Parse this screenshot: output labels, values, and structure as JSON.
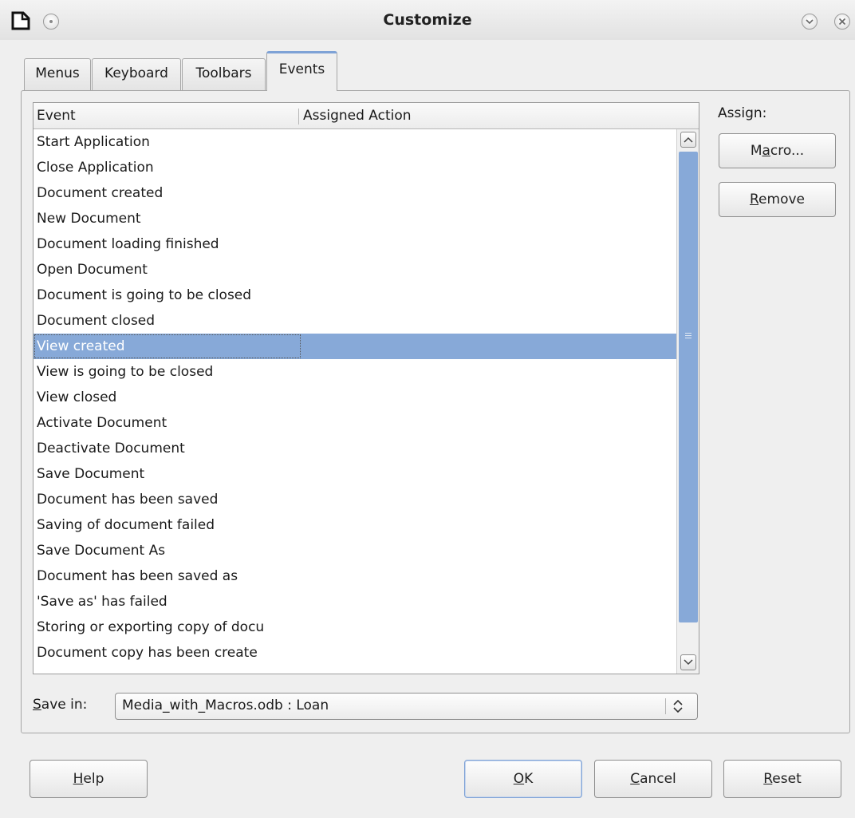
{
  "window": {
    "title": "Customize"
  },
  "tabs": [
    {
      "label": "Menus",
      "active": false
    },
    {
      "label": "Keyboard",
      "active": false
    },
    {
      "label": "Toolbars",
      "active": false
    },
    {
      "label": "Events",
      "active": true
    }
  ],
  "events_list": {
    "columns": [
      "Event",
      "Assigned Action"
    ],
    "selected_index": 8,
    "rows": [
      "Start Application",
      "Close Application",
      "Document created",
      "New Document",
      "Document loading finished",
      "Open Document",
      "Document is going to be closed",
      "Document closed",
      "View created",
      "View is going to be closed",
      "View closed",
      "Activate Document",
      "Deactivate Document",
      "Save Document",
      "Document has been saved",
      "Saving of document failed",
      "Save Document As",
      "Document has been saved as",
      "'Save as' has failed",
      "Storing or exporting copy of docu",
      "Document copy has been create"
    ]
  },
  "assign": {
    "label": "Assign:",
    "macro_button": {
      "prefix": "M",
      "mnemonic": "a",
      "suffix": "cro..."
    },
    "remove_button": {
      "prefix": "",
      "mnemonic": "R",
      "suffix": "emove"
    }
  },
  "save_in": {
    "label_mnemonic": "S",
    "label_rest": "ave in:",
    "value": "Media_with_Macros.odb : Loan"
  },
  "footer": {
    "help": {
      "mnemonic": "H",
      "rest": "elp"
    },
    "ok": {
      "mnemonic": "O",
      "rest": "K"
    },
    "cancel": {
      "mnemonic": "C",
      "rest": "ancel"
    },
    "reset": {
      "mnemonic": "R",
      "rest": "eset"
    }
  },
  "colors": {
    "selection": "#87a9d8",
    "active_tab_accent": "#7ea2d6"
  },
  "icons": {
    "app": "document-icon",
    "menu": "window-menu-icon",
    "minimize": "minimize-icon",
    "close": "close-icon",
    "scroll_up": "chevron-up-icon",
    "scroll_down": "chevron-down-icon",
    "combo": "spin-arrows-icon"
  }
}
